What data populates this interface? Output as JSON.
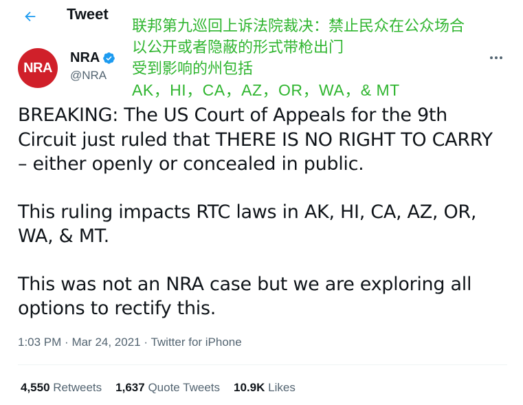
{
  "header": {
    "title": "Tweet",
    "back_icon": "arrow-left-icon"
  },
  "overlay": {
    "line1": "联邦第九巡回上诉法院裁决：禁止民众在公众场合",
    "line2": "以公开或者隐蔽的形式带枪出门",
    "line3": "受到影响的州包括",
    "line4": "AK，HI，CA，AZ，OR，WA，& MT",
    "color": "#2fb52f"
  },
  "author": {
    "avatar_text": "NRA",
    "name": "NRA",
    "handle": "@NRA",
    "verified_icon": "verified-badge-icon",
    "avatar_color": "#d0202a"
  },
  "tweet": {
    "paragraphs": [
      "BREAKING: The US Court of Appeals for the 9th Circuit just ruled that THERE IS NO RIGHT TO CARRY – either openly or concealed in public.",
      "This ruling impacts RTC laws in AK, HI, CA, AZ, OR, WA, & MT.",
      "This was not an NRA case but we are exploring all options to rectify this."
    ],
    "time": "1:03 PM",
    "date": "Mar 24, 2021",
    "source": "Twitter for iPhone"
  },
  "stats": {
    "retweets_count": "4,550",
    "retweets_label": "Retweets",
    "quotes_count": "1,637",
    "quotes_label": "Quote Tweets",
    "likes_count": "10.9K",
    "likes_label": "Likes"
  },
  "colors": {
    "accent": "#1d9bf0",
    "text": "#0f1419",
    "secondary": "#536471"
  }
}
